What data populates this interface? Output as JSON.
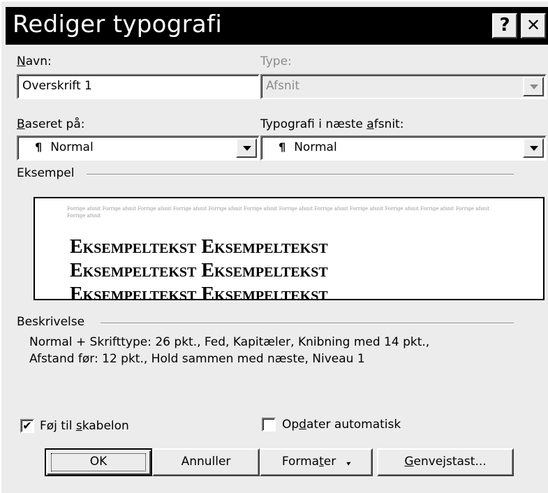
{
  "window": {
    "title": "Rediger typografi",
    "help_glyph": "?",
    "close_glyph": "✕"
  },
  "name_field": {
    "label_key": "N",
    "label_rest": "avn:",
    "value": "Overskrift 1"
  },
  "type_field": {
    "label": "Type:",
    "value": "Afsnit"
  },
  "based_on": {
    "label_key": "B",
    "label_rest": "aseret på:",
    "value": "Normal",
    "icon": "¶"
  },
  "next_style": {
    "label_pre": "Typografi i næste ",
    "label_key": "a",
    "label_post": "fsnit:",
    "value": "Normal",
    "icon": "¶"
  },
  "preview": {
    "label": "Eksempel",
    "preceding_text": "Forrige afsnit Forrige afsnit Forrige afsnit Forrige afsnit Forrige afsnit Forrige afsnit Forrige afsnit Forrige afsnit Forrige afsnit Forrige afsnit Forrige afsnit Forrige afsnit Forrige afsnit",
    "sample_lines": [
      "Eksempeltekst Eksempeltekst",
      "Eksempeltekst Eksempeltekst",
      "Eksempeltekst Eksempeltekst"
    ]
  },
  "description": {
    "label": "Beskrivelse",
    "lines": [
      "Normal + Skrifttype: 26 pkt., Fed, Kapitæler, Knibning med 14 pkt.,",
      "Afstand før: 12 pkt., Hold sammen med næste, Niveau 1"
    ]
  },
  "add_to_template": {
    "label_pre": "Føj til ",
    "label_key": "s",
    "label_post": "kabelon",
    "checked": true
  },
  "auto_update": {
    "label_pre": "Op",
    "label_key": "d",
    "label_post": "ater automatisk",
    "checked": false
  },
  "buttons": {
    "ok": "OK",
    "cancel": "Annuller",
    "format_pre": "Forma",
    "format_key": "t",
    "format_post": "er",
    "format_arrow": "▸",
    "shortcut_key": "G",
    "shortcut_rest": "envejstast..."
  },
  "check_glyph": "✔"
}
